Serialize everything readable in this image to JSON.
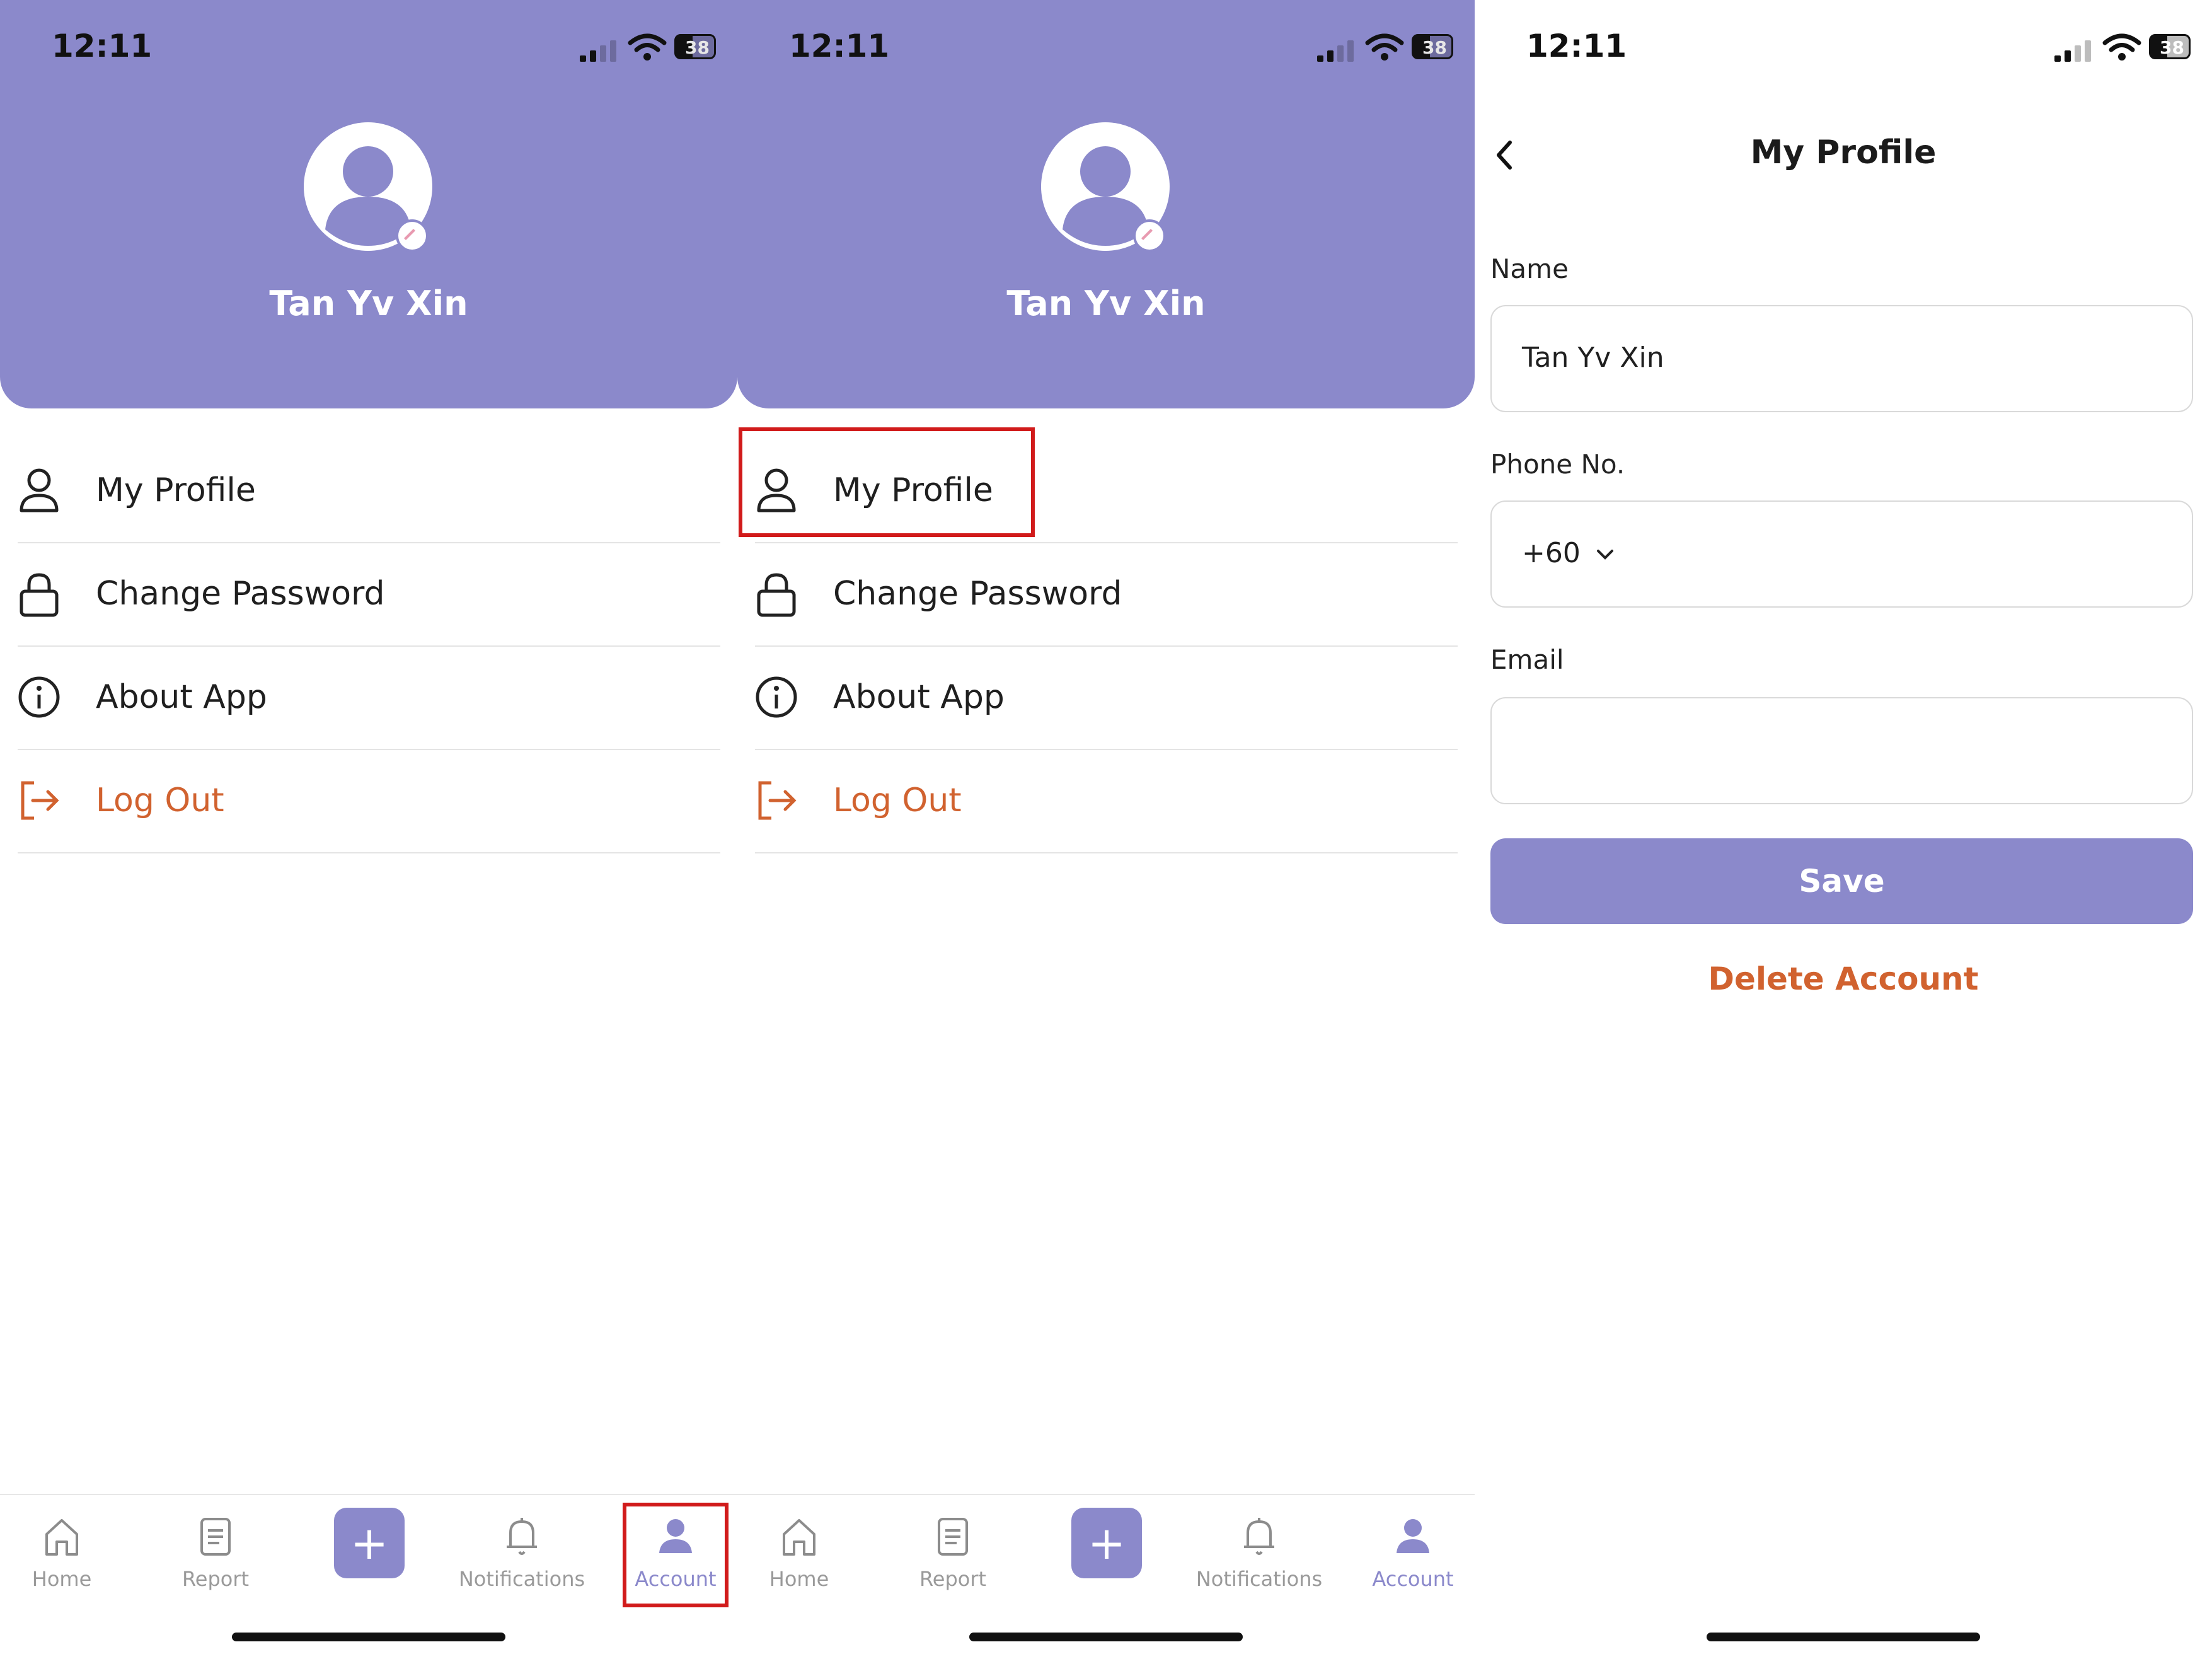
{
  "status": {
    "time": "12:11",
    "battery": "38"
  },
  "account": {
    "user_name": "Tan Yv Xin",
    "menu": [
      {
        "label": "My Profile",
        "icon": "person-icon"
      },
      {
        "label": "Change Password",
        "icon": "lock-icon"
      },
      {
        "label": "About App",
        "icon": "info-icon"
      },
      {
        "label": "Log Out",
        "icon": "logout-icon"
      }
    ]
  },
  "nav": {
    "home": "Home",
    "report": "Report",
    "add": "+",
    "notifications": "Notifications",
    "account": "Account"
  },
  "profile": {
    "title": "My Profile",
    "name_label": "Name",
    "name_value": "Tan Yv Xin",
    "phone_label": "Phone No.",
    "phone_code": "+60",
    "email_label": "Email",
    "email_value": "",
    "save": "Save",
    "delete": "Delete Account"
  },
  "colors": {
    "accent": "#8b89cb",
    "danger": "#d1622f",
    "highlight": "#d11b1b"
  }
}
